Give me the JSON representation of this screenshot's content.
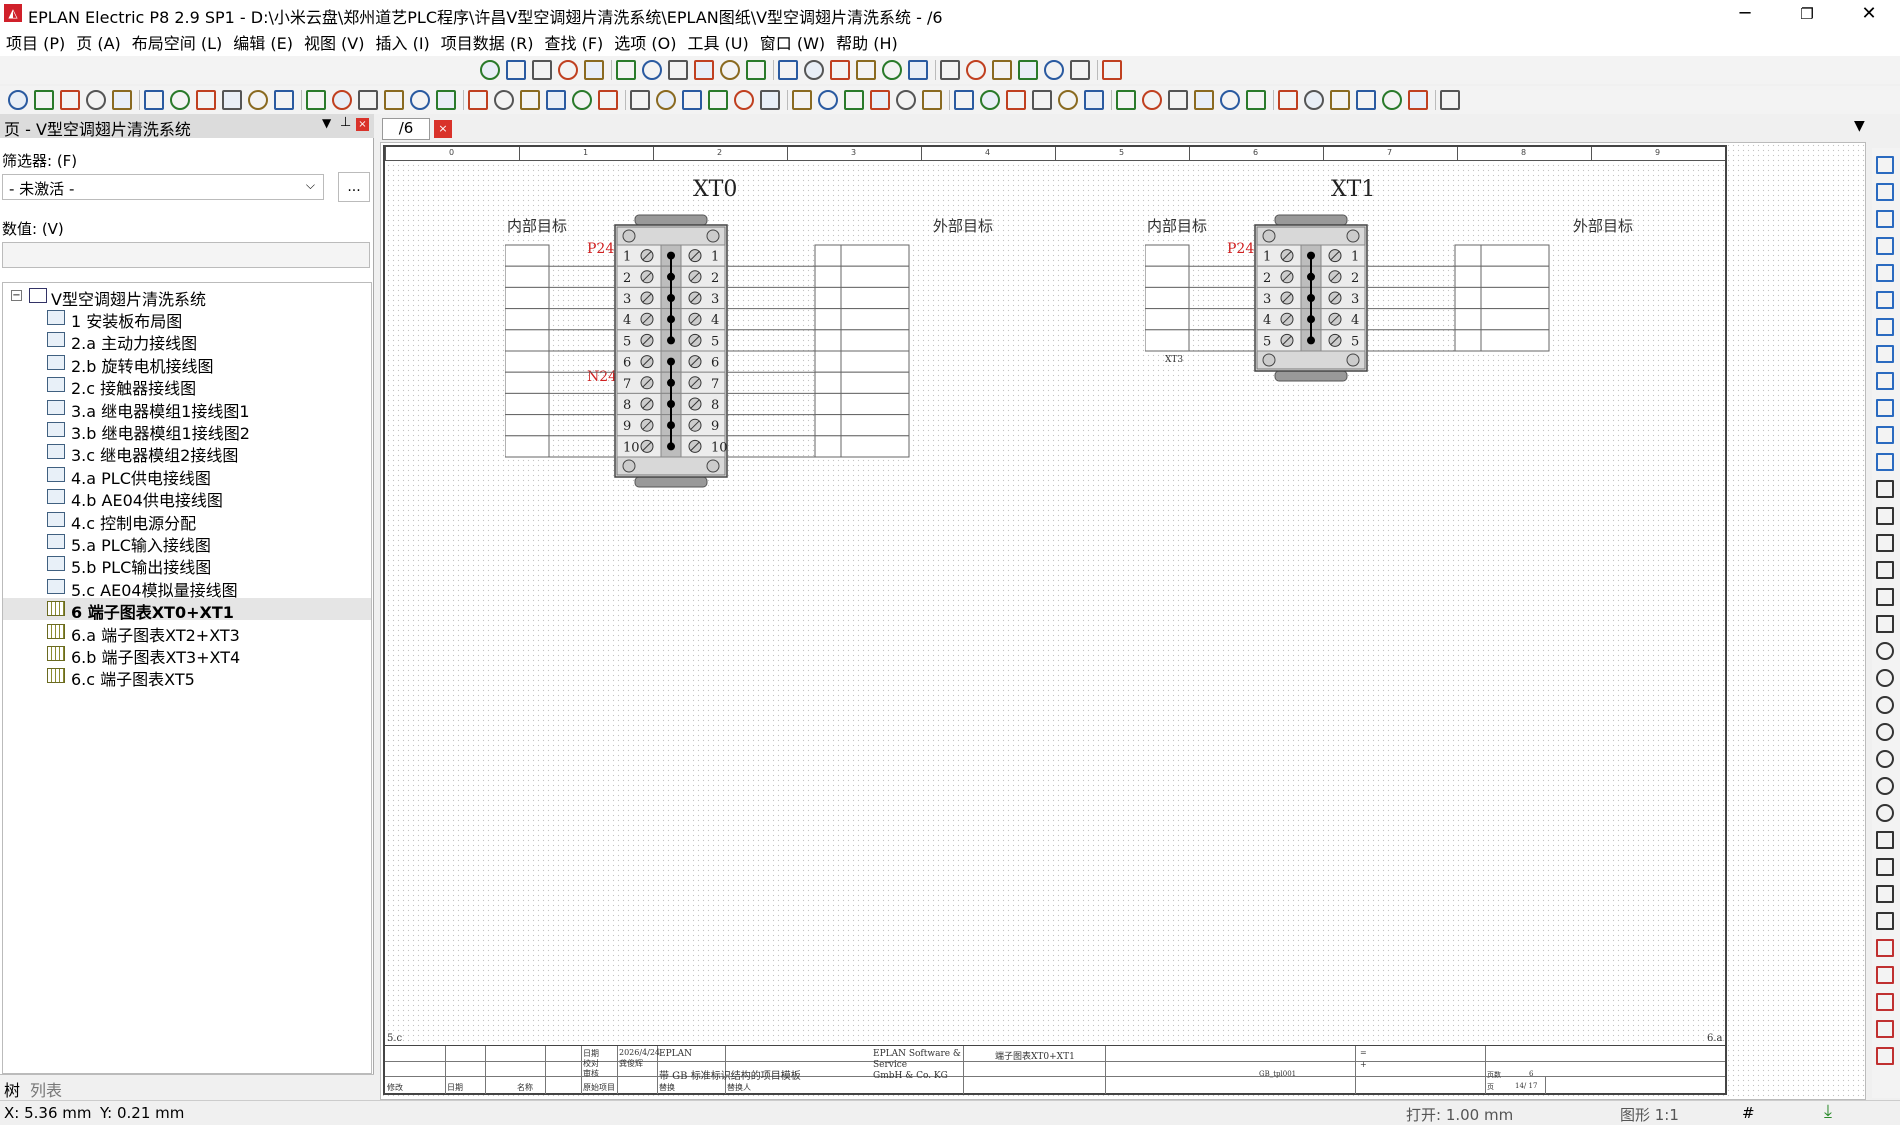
{
  "window": {
    "title": "EPLAN Electric P8 2.9 SP1 - D:\\小米云盘\\郑州道艺PLC程序\\许昌V型空调翅片清洗系统\\EPLAN图纸\\V型空调翅片清洗系统 - /6",
    "minimize": "─",
    "restore": "❐",
    "close": "✕"
  },
  "menu": [
    "项目 (P)",
    "页 (A)",
    "布局空间 (L)",
    "编辑 (E)",
    "视图 (V)",
    "插入 (I)",
    "项目数据 (R)",
    "查找 (F)",
    "选项 (O)",
    "工具 (U)",
    "窗口 (W)",
    "帮助 (H)"
  ],
  "panel": {
    "title": "页 - V型空调翅片清洗系统",
    "filter_label": "筛选器: (F)",
    "filter_value": "- 未激活 -",
    "filter_button": "...",
    "value_label": "数值: (V)",
    "tabs": [
      "树",
      "列表"
    ]
  },
  "tree": {
    "root": "V型空调翅片清洗系统",
    "collapse_glyph": "−",
    "items": [
      {
        "label": "1 安装板布局图",
        "type": "layout"
      },
      {
        "label": "2.a 主动力接线图",
        "type": "schematic"
      },
      {
        "label": "2.b 旋转电机接线图",
        "type": "schematic"
      },
      {
        "label": "2.c 接触器接线图",
        "type": "schematic"
      },
      {
        "label": "3.a 继电器模组1接线图1",
        "type": "schematic"
      },
      {
        "label": "3.b 继电器模组1接线图2",
        "type": "schematic"
      },
      {
        "label": "3.c 继电器模组2接线图",
        "type": "schematic"
      },
      {
        "label": "4.a PLC供电接线图",
        "type": "schematic"
      },
      {
        "label": "4.b AE04供电接线图",
        "type": "schematic"
      },
      {
        "label": "4.c 控制电源分配",
        "type": "schematic"
      },
      {
        "label": "5.a PLC输入接线图",
        "type": "schematic"
      },
      {
        "label": "5.b PLC输出接线图",
        "type": "schematic"
      },
      {
        "label": "5.c AE04模拟量接线图",
        "type": "schematic"
      },
      {
        "label": "6 端子图表XT0+XT1",
        "type": "table",
        "selected": true
      },
      {
        "label": "6.a 端子图表XT2+XT3",
        "type": "table"
      },
      {
        "label": "6.b 端子图表XT3+XT4",
        "type": "table"
      },
      {
        "label": "6.c 端子图表XT5",
        "type": "table"
      }
    ]
  },
  "doc_tab": {
    "label": "/6",
    "close": "×",
    "dropdown": "▼"
  },
  "ruler": [
    "0",
    "1",
    "2",
    "3",
    "4",
    "5",
    "6",
    "7",
    "8",
    "9"
  ],
  "sheet": {
    "corner_left": "5.c",
    "corner_right": "6.a",
    "strips": [
      {
        "name": "XT0",
        "inner": "内部目标",
        "outer": "外部目标",
        "labels": {
          "P24": "P24",
          "N24": "N24"
        },
        "count": 10
      },
      {
        "name": "XT1",
        "inner": "内部目标",
        "outer": "外部目标",
        "labels": {
          "P24": "P24",
          "XT3": "XT3"
        },
        "count": 5
      }
    ],
    "titleblock": {
      "date_label": "日期",
      "date": "2026/4/24",
      "check_label": "校对",
      "checker": "龚俊辉",
      "review_label": "审核",
      "orig_label": "原始项目",
      "modify_label": "修改",
      "date2_label": "日期",
      "name_label": "名称",
      "replace_label": "替换",
      "replaced_by_label": "替换人",
      "company1": "EPLAN",
      "template": "带 GB 标准标识结构的项目模板",
      "vendor": [
        "EPLAN Software &",
        "Service",
        "GmbH & Co. KG"
      ],
      "page_title": "端子图表XT0+XT1",
      "eq1": "=",
      "eq2": "+",
      "template_code": "GB_tpl001",
      "page_label": "页数",
      "page_num": "6",
      "sheet_label": "页",
      "sheet_of": "14/ 17"
    }
  },
  "status": {
    "x": "X: 5.36 mm",
    "y": "Y: 0.21 mm",
    "open": "打开: 1.00 mm",
    "scale": "图形 1:1",
    "hash": "#"
  }
}
